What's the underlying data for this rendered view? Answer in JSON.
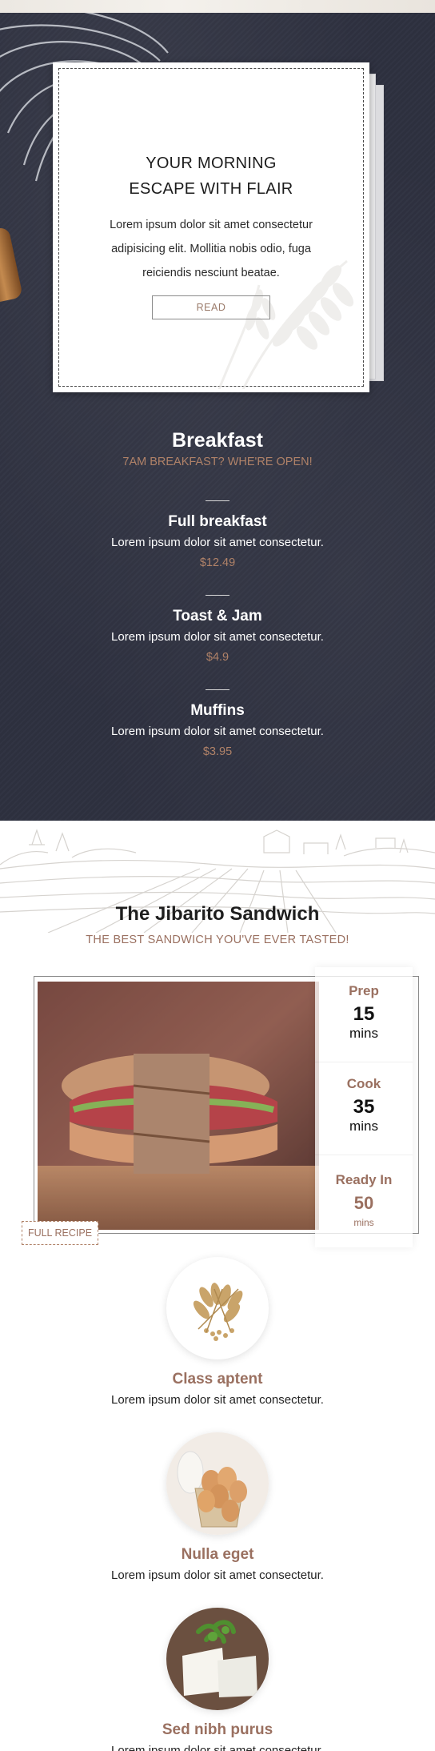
{
  "hero_card": {
    "title_line1": "YOUR MORNING",
    "title_line2": "ESCAPE WITH FLAIR",
    "text": "Lorem ipsum dolor sit amet consectetur adipisicing elit. Mollitia nobis odio, fuga reiciendis nesciunt beatae.",
    "read_label": "READ"
  },
  "breakfast": {
    "title": "Breakfast",
    "subtitle": "7AM BREAKFAST? WHE'RE OPEN!",
    "items": [
      {
        "name": "Full breakfast",
        "desc": "Lorem ipsum dolor sit amet consectetur.",
        "price": "$12.49"
      },
      {
        "name": "Toast & Jam",
        "desc": "Lorem ipsum dolor sit amet consectetur.",
        "price": "$4.9"
      },
      {
        "name": "Muffins",
        "desc": "Lorem ipsum dolor sit amet consectetur.",
        "price": "$3.95"
      }
    ]
  },
  "recipe": {
    "title": "The Jibarito Sandwich",
    "subtitle": "THE BEST SANDWICH YOU'VE EVER TASTED!",
    "full_recipe_label": "FULL RECIPE",
    "timings": [
      {
        "label": "Prep",
        "value": "15",
        "unit": "mins"
      },
      {
        "label": "Cook",
        "value": "35",
        "unit": "mins"
      },
      {
        "label": "Ready In",
        "value": "50",
        "unit": "mins"
      }
    ]
  },
  "features": [
    {
      "title": "Class aptent",
      "text": "Lorem ipsum dolor sit amet consectetur.",
      "icon": "wheat-grain-image"
    },
    {
      "title": "Nulla eget",
      "text": "Lorem ipsum dolor sit amet consectetur.",
      "icon": "eggs-basket-image"
    },
    {
      "title": "Sed nibh purus",
      "text": "Lorem ipsum dolor sit amet consectetur.",
      "icon": "cheese-image"
    }
  ],
  "colors": {
    "slate": "#2e3140",
    "accent": "#b08268",
    "accent_dark": "#9a7060"
  }
}
